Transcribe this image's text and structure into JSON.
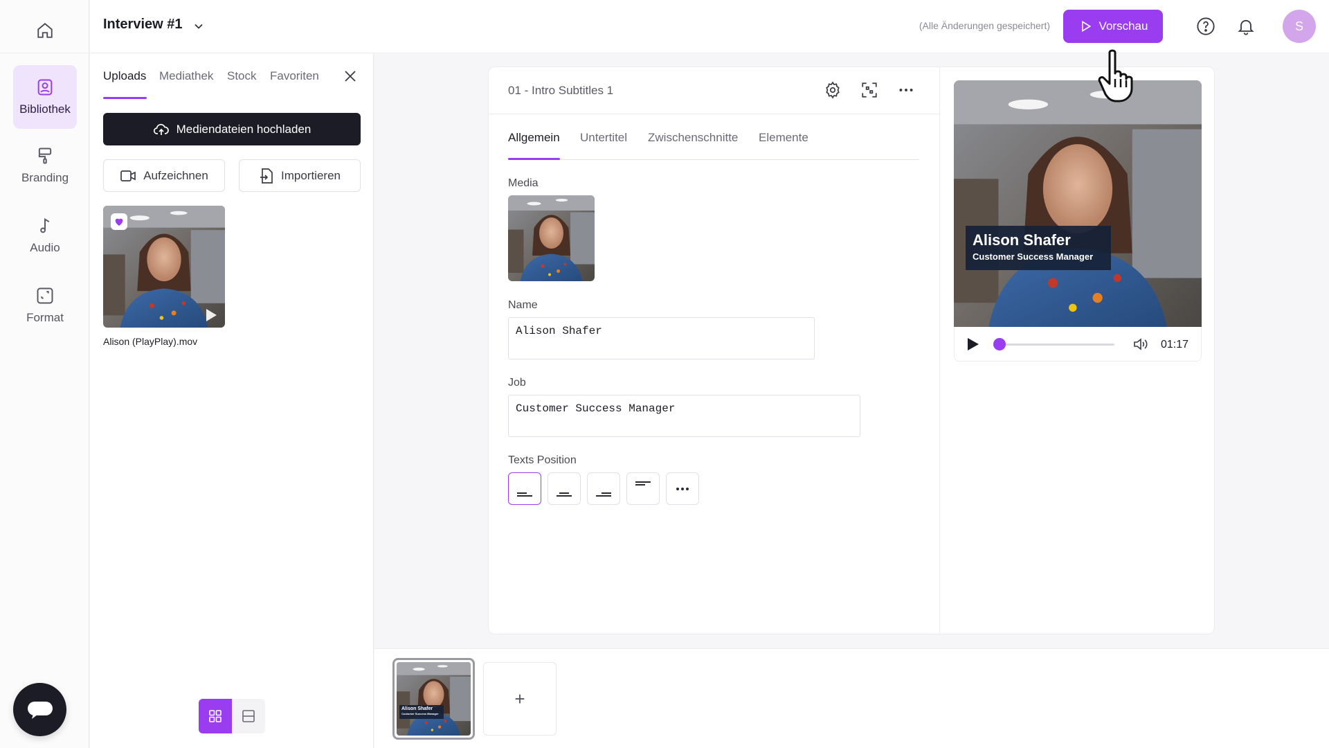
{
  "app": {
    "project_title": "Interview #1",
    "save_status": "(Alle Änderungen gespeichert)",
    "preview_label": "Vorschau",
    "avatar_initial": "S",
    "accent": "#9a3df0"
  },
  "rail": {
    "items": [
      {
        "label": "Bibliothek",
        "icon": "image-library-icon",
        "active": true
      },
      {
        "label": "Branding",
        "icon": "paint-roller-icon"
      },
      {
        "label": "Audio",
        "icon": "music-note-icon"
      },
      {
        "label": "Format",
        "icon": "resize-icon"
      }
    ]
  },
  "library": {
    "tabs": [
      "Uploads",
      "Mediathek",
      "Stock",
      "Favoriten"
    ],
    "upload_label": "Mediendateien hochladen",
    "record_label": "Aufzeichnen",
    "import_label": "Importieren",
    "media_items": [
      {
        "filename": "Alison (PlayPlay).mov",
        "favorite": true
      }
    ]
  },
  "editor": {
    "scene_title": "01 - Intro Subtitles 1",
    "tabs": [
      "Allgemein",
      "Untertitel",
      "Zwischenschnitte",
      "Elemente"
    ],
    "media_label": "Media",
    "name_label": "Name",
    "name_value": "Alison Shafer",
    "job_label": "Job",
    "job_value": "Customer Success Manager",
    "position_label": "Texts Position"
  },
  "preview": {
    "lower_third_name": "Alison Shafer",
    "lower_third_job": "Customer Success Manager",
    "time": "01:17",
    "progress": 0.0
  },
  "timeline": {
    "scene_thumb_name": "Alison Shafer",
    "scene_thumb_job": "Customer Success Manager",
    "add_label": "+"
  }
}
